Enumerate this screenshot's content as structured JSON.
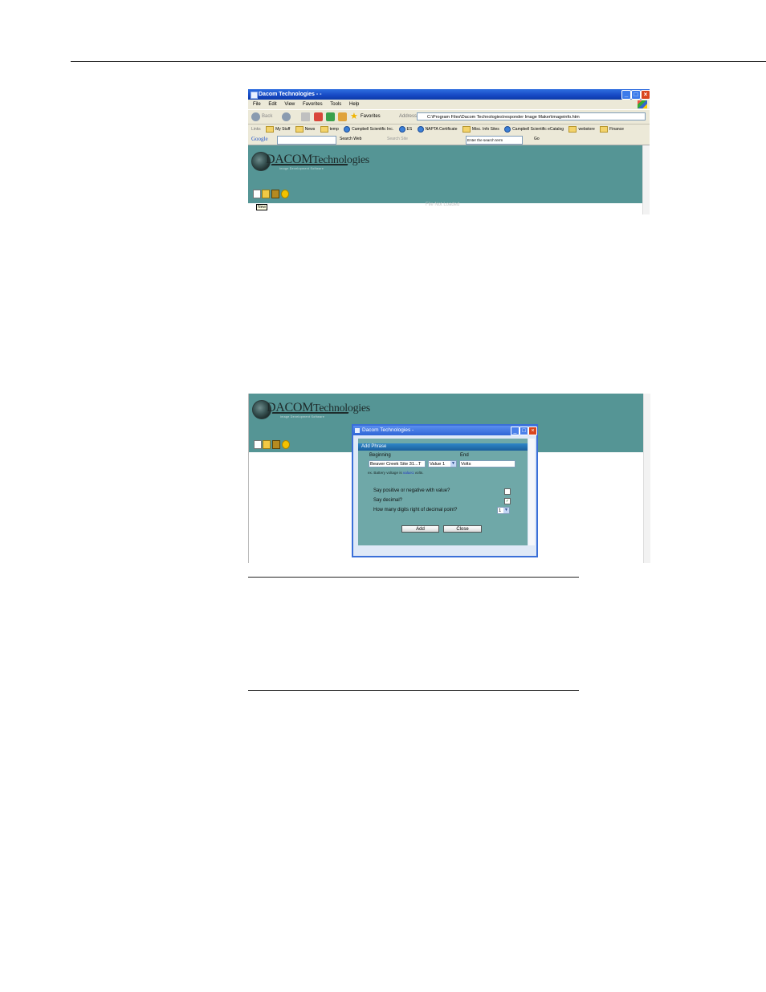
{
  "browser": {
    "title": "Dacom Technologies - -",
    "menu": [
      "File",
      "Edit",
      "View",
      "Favorites",
      "Tools",
      "Help"
    ],
    "toolbar": {
      "back": "Back",
      "favorites": "Favorites",
      "address_label": "Address",
      "address": "C:\\Program Files\\Dacom Technologies\\responder Image Maker\\imageinfo.htm"
    },
    "links_label": "Links",
    "links": [
      "My Stuff",
      "News",
      "temp",
      "Campbell Scientific Inc.",
      "ES",
      "NAPTA Certificate",
      "Misc. Info Sites",
      "Campbell Scientific eCatalog",
      "webstore",
      "Finance"
    ],
    "google": {
      "brand": "Google",
      "search_web": "Search Web",
      "search_site": "Search Site",
      "search_term": "Enter the search term",
      "go": "Go"
    }
  },
  "app": {
    "logo": {
      "brand_prefix": "DACOM",
      "brand_suffix": "Technologies",
      "tagline": "Image Development Software"
    },
    "tooltip": "New",
    "status": "File Not Loaded"
  },
  "dialog": {
    "title": "Dacom Technologies -",
    "header": "Add Phrase",
    "beginning_label": "Beginning",
    "end_label": "End",
    "beginning_value": "Beaver Creek Site 31...T",
    "value_select": "Value 1",
    "end_value": "Volts",
    "hint_prefix": "ex. Battery voltage is",
    "hint_value": "value1",
    "hint_suffix": "volts.",
    "q_sign": "Say positive or negative with value?",
    "q_decimal": "Say decimal?",
    "q_digits": "How many digits right of decimal point?",
    "sign_checked": false,
    "decimal_checked": true,
    "digits_value": "1",
    "add_button": "Add",
    "close_button": "Close"
  }
}
